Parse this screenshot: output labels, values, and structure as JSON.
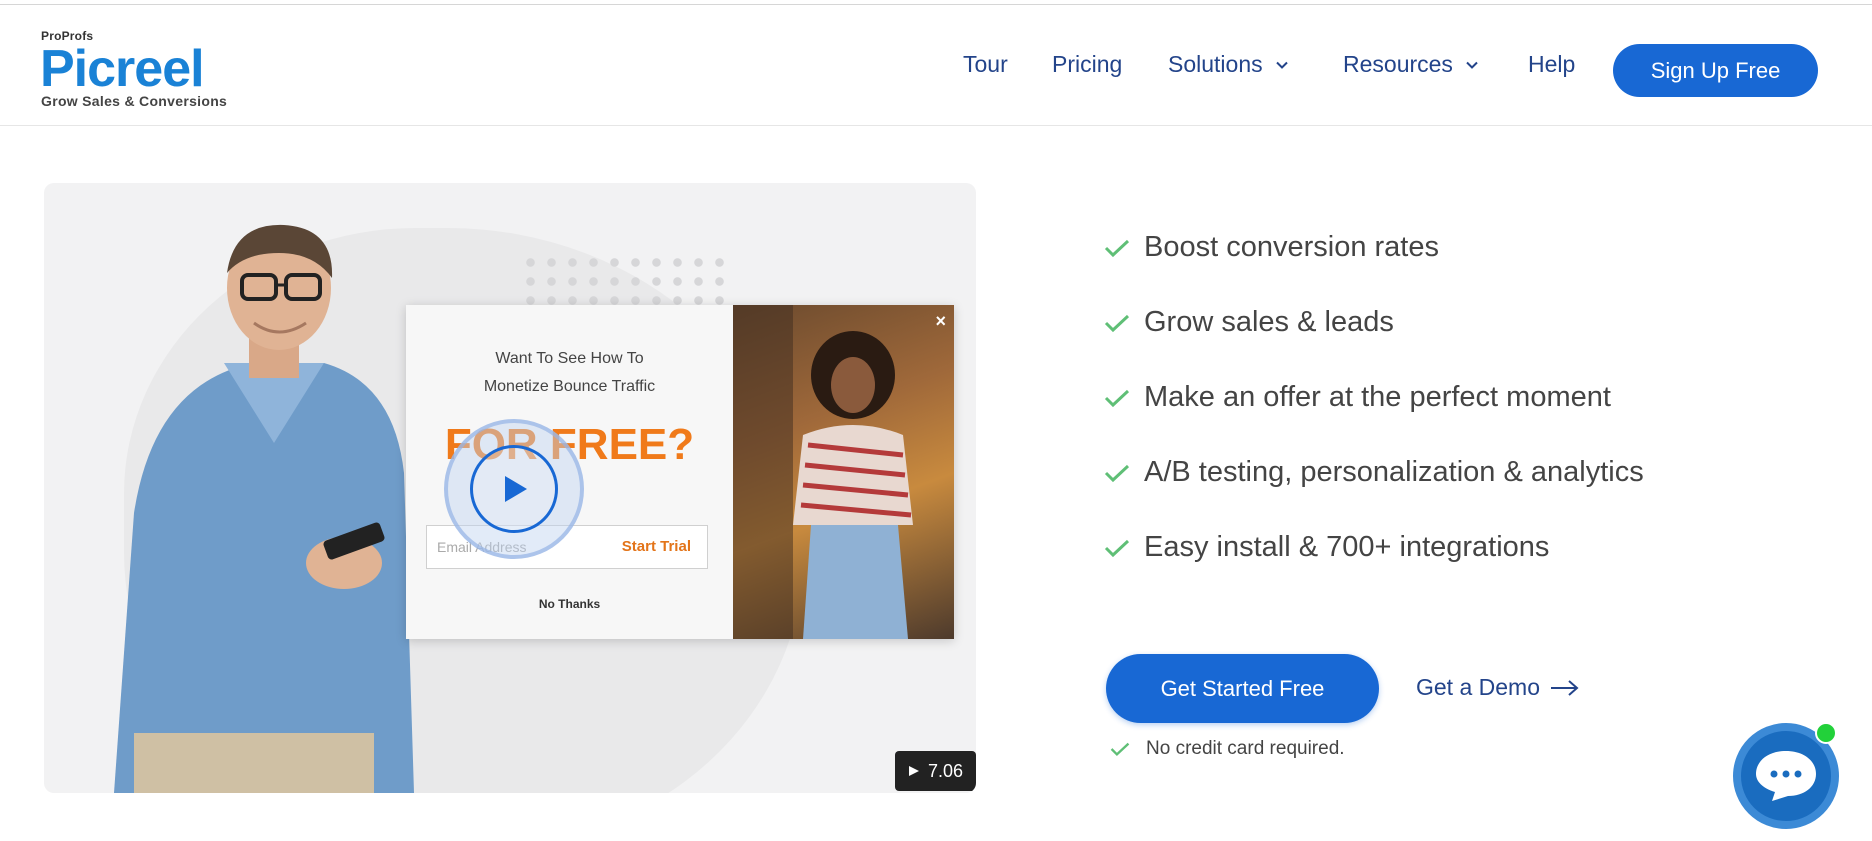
{
  "brand": {
    "parent": "ProProfs",
    "name": "Picreel",
    "tagline": "Grow Sales & Conversions",
    "color": "#1a82d6"
  },
  "nav": {
    "tour": "Tour",
    "pricing": "Pricing",
    "solutions": "Solutions",
    "resources": "Resources",
    "help": "Help",
    "signup": "Sign Up Free"
  },
  "video": {
    "popup": {
      "line1": "Want To See How To",
      "line2": "Monetize Bounce Traffic",
      "headline": "FOR FREE?",
      "email_placeholder": "Email Address",
      "cta": "Start Trial",
      "dismiss": "No Thanks",
      "close": "×"
    },
    "duration": "7.06"
  },
  "features": [
    "Boost conversion rates",
    "Grow sales & leads",
    "Make an offer at the perfect moment",
    "A/B testing, personalization & analytics",
    "Easy install & 700+ integrations"
  ],
  "cta": {
    "primary": "Get Started Free",
    "secondary": "Get a Demo",
    "note": "No credit card required."
  },
  "colors": {
    "accent": "#1868d4",
    "nav_text": "#23448a",
    "check": "#5fbf76",
    "popup_orange": "#f07a1a",
    "chat_online": "#22d13a"
  },
  "icons": {
    "chevron": "chevron-down-icon",
    "check": "check-icon",
    "arrow": "arrow-right-icon",
    "play": "play-icon",
    "chat": "chat-icon"
  }
}
